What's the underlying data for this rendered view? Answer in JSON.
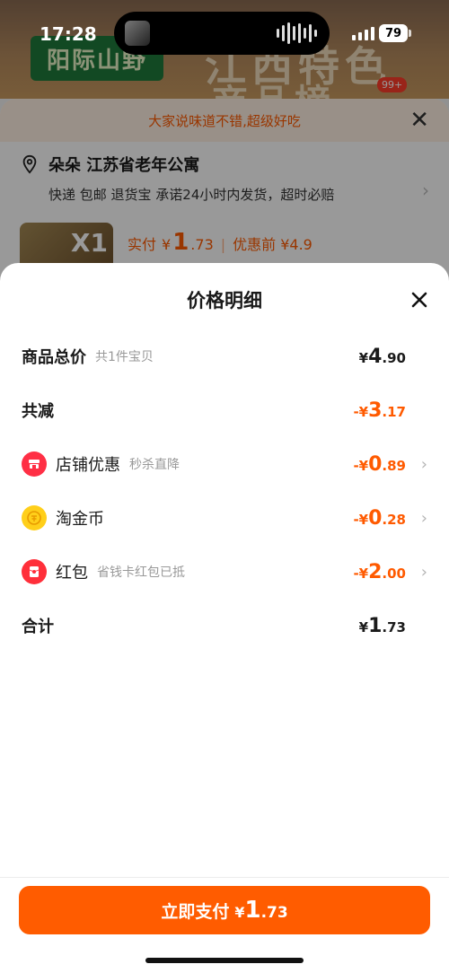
{
  "status_bar": {
    "time": "17:28",
    "battery": "79"
  },
  "background": {
    "brand_label": "阳际山野",
    "hero_title_line1": "江西特色",
    "hero_title_line2": "商品榜",
    "hero_badge": "99+",
    "notice": "大家说味道不错,超级好吃",
    "address_name": "朵朵 江苏省老年公寓",
    "delivery_info": "快递 包邮 退货宝 承诺24小时内发货，超时必赔",
    "product_qty": "X1",
    "paid_label": "实付",
    "paid_currency": "¥",
    "paid_int": "1",
    "paid_dec": ".73",
    "pre_discount": "优惠前 ¥4.9"
  },
  "sheet": {
    "title": "价格明细",
    "rows": {
      "total": {
        "label": "商品总价",
        "sub": "共1件宝贝",
        "pre": "¥",
        "int": "4",
        "dec": ".90"
      },
      "reduction": {
        "label": "共减",
        "pre": "-¥",
        "int": "3",
        "dec": ".17"
      },
      "shop_discount": {
        "label": "店铺优惠",
        "sub": "秒杀直降",
        "pre": "-¥",
        "int": "0",
        "dec": ".89"
      },
      "taojinbi": {
        "label": "淘金币",
        "pre": "-¥",
        "int": "0",
        "dec": ".28"
      },
      "hongbao": {
        "label": "红包",
        "sub": "省钱卡红包已抵",
        "pre": "-¥",
        "int": "2",
        "dec": ".00"
      },
      "sum": {
        "label": "合计",
        "pre": "¥",
        "int": "1",
        "dec": ".73"
      }
    },
    "pay_button": {
      "label": "立即支付",
      "pre": "¥",
      "int": "1",
      "dec": ".73"
    }
  },
  "colors": {
    "accent": "#ff5c00",
    "discount": "#ff5a00"
  }
}
